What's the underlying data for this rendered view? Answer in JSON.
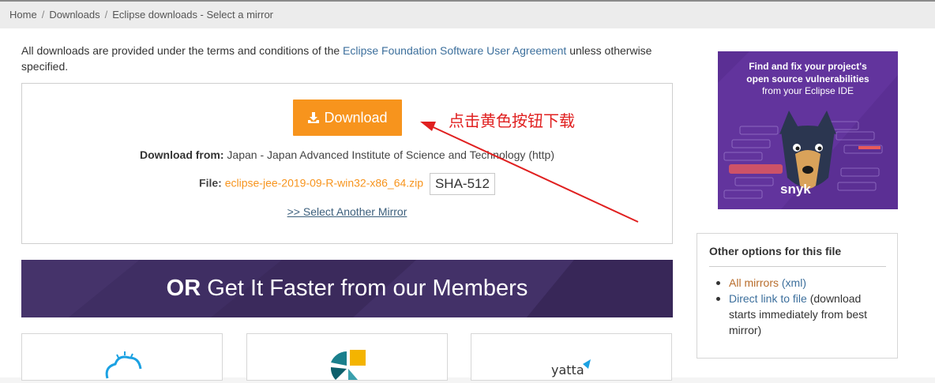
{
  "breadcrumb": {
    "home": "Home",
    "downloads": "Downloads",
    "current": "Eclipse downloads - Select a mirror",
    "separator": "/"
  },
  "terms": {
    "prefix": "All downloads are provided under the terms and conditions of the",
    "link": "Eclipse Foundation Software User Agreement",
    "suffix": "unless otherwise specified."
  },
  "download": {
    "button_label": "Download",
    "from_label": "Download from:",
    "from_value": "Japan - Japan Advanced Institute of Science and Technology (http)",
    "file_label": "File:",
    "file_name": "eclipse-jee-2019-09-R-win32-x86_64.zip",
    "sha_label": "SHA-512",
    "mirror_link": ">> Select Another Mirror"
  },
  "annotation": {
    "text": "点击黄色按钮下载",
    "color": "#e02020"
  },
  "members_banner": {
    "bold": "OR",
    "text": "Get It Faster from our Members"
  },
  "members": [
    {
      "name": "ibm-cloud-icon"
    },
    {
      "name": "member-logo-icon"
    },
    {
      "name": "yatta-logo",
      "label": "yatta"
    }
  ],
  "ad": {
    "title_line1": "Find and fix your project's",
    "title_line2": "open source vulnerabilities",
    "subtitle": "from your Eclipse IDE",
    "brand": "snyk"
  },
  "options": {
    "heading": "Other options for this file",
    "items": [
      {
        "link": "All mirrors",
        "extra_link": "(xml)"
      },
      {
        "link": "Direct link to file",
        "text": "(download starts immediately from best mirror)"
      }
    ]
  },
  "colors": {
    "download_button": "#f7941d",
    "link_blue": "#3c6f9c",
    "banner": "#3b2a5c",
    "ad_background": "#5b2f94"
  }
}
